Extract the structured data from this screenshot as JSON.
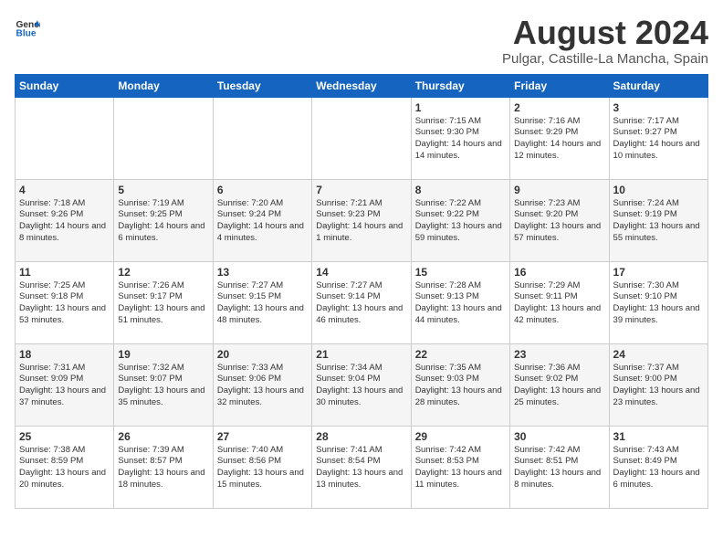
{
  "header": {
    "logo_general": "General",
    "logo_blue": "Blue",
    "title": "August 2024",
    "subtitle": "Pulgar, Castille-La Mancha, Spain"
  },
  "weekdays": [
    "Sunday",
    "Monday",
    "Tuesday",
    "Wednesday",
    "Thursday",
    "Friday",
    "Saturday"
  ],
  "weeks": [
    [
      {
        "day": "",
        "info": ""
      },
      {
        "day": "",
        "info": ""
      },
      {
        "day": "",
        "info": ""
      },
      {
        "day": "",
        "info": ""
      },
      {
        "day": "1",
        "info": "Sunrise: 7:15 AM\nSunset: 9:30 PM\nDaylight: 14 hours and 14 minutes."
      },
      {
        "day": "2",
        "info": "Sunrise: 7:16 AM\nSunset: 9:29 PM\nDaylight: 14 hours and 12 minutes."
      },
      {
        "day": "3",
        "info": "Sunrise: 7:17 AM\nSunset: 9:27 PM\nDaylight: 14 hours and 10 minutes."
      }
    ],
    [
      {
        "day": "4",
        "info": "Sunrise: 7:18 AM\nSunset: 9:26 PM\nDaylight: 14 hours and 8 minutes."
      },
      {
        "day": "5",
        "info": "Sunrise: 7:19 AM\nSunset: 9:25 PM\nDaylight: 14 hours and 6 minutes."
      },
      {
        "day": "6",
        "info": "Sunrise: 7:20 AM\nSunset: 9:24 PM\nDaylight: 14 hours and 4 minutes."
      },
      {
        "day": "7",
        "info": "Sunrise: 7:21 AM\nSunset: 9:23 PM\nDaylight: 14 hours and 1 minute."
      },
      {
        "day": "8",
        "info": "Sunrise: 7:22 AM\nSunset: 9:22 PM\nDaylight: 13 hours and 59 minutes."
      },
      {
        "day": "9",
        "info": "Sunrise: 7:23 AM\nSunset: 9:20 PM\nDaylight: 13 hours and 57 minutes."
      },
      {
        "day": "10",
        "info": "Sunrise: 7:24 AM\nSunset: 9:19 PM\nDaylight: 13 hours and 55 minutes."
      }
    ],
    [
      {
        "day": "11",
        "info": "Sunrise: 7:25 AM\nSunset: 9:18 PM\nDaylight: 13 hours and 53 minutes."
      },
      {
        "day": "12",
        "info": "Sunrise: 7:26 AM\nSunset: 9:17 PM\nDaylight: 13 hours and 51 minutes."
      },
      {
        "day": "13",
        "info": "Sunrise: 7:27 AM\nSunset: 9:15 PM\nDaylight: 13 hours and 48 minutes."
      },
      {
        "day": "14",
        "info": "Sunrise: 7:27 AM\nSunset: 9:14 PM\nDaylight: 13 hours and 46 minutes."
      },
      {
        "day": "15",
        "info": "Sunrise: 7:28 AM\nSunset: 9:13 PM\nDaylight: 13 hours and 44 minutes."
      },
      {
        "day": "16",
        "info": "Sunrise: 7:29 AM\nSunset: 9:11 PM\nDaylight: 13 hours and 42 minutes."
      },
      {
        "day": "17",
        "info": "Sunrise: 7:30 AM\nSunset: 9:10 PM\nDaylight: 13 hours and 39 minutes."
      }
    ],
    [
      {
        "day": "18",
        "info": "Sunrise: 7:31 AM\nSunset: 9:09 PM\nDaylight: 13 hours and 37 minutes."
      },
      {
        "day": "19",
        "info": "Sunrise: 7:32 AM\nSunset: 9:07 PM\nDaylight: 13 hours and 35 minutes."
      },
      {
        "day": "20",
        "info": "Sunrise: 7:33 AM\nSunset: 9:06 PM\nDaylight: 13 hours and 32 minutes."
      },
      {
        "day": "21",
        "info": "Sunrise: 7:34 AM\nSunset: 9:04 PM\nDaylight: 13 hours and 30 minutes."
      },
      {
        "day": "22",
        "info": "Sunrise: 7:35 AM\nSunset: 9:03 PM\nDaylight: 13 hours and 28 minutes."
      },
      {
        "day": "23",
        "info": "Sunrise: 7:36 AM\nSunset: 9:02 PM\nDaylight: 13 hours and 25 minutes."
      },
      {
        "day": "24",
        "info": "Sunrise: 7:37 AM\nSunset: 9:00 PM\nDaylight: 13 hours and 23 minutes."
      }
    ],
    [
      {
        "day": "25",
        "info": "Sunrise: 7:38 AM\nSunset: 8:59 PM\nDaylight: 13 hours and 20 minutes."
      },
      {
        "day": "26",
        "info": "Sunrise: 7:39 AM\nSunset: 8:57 PM\nDaylight: 13 hours and 18 minutes."
      },
      {
        "day": "27",
        "info": "Sunrise: 7:40 AM\nSunset: 8:56 PM\nDaylight: 13 hours and 15 minutes."
      },
      {
        "day": "28",
        "info": "Sunrise: 7:41 AM\nSunset: 8:54 PM\nDaylight: 13 hours and 13 minutes."
      },
      {
        "day": "29",
        "info": "Sunrise: 7:42 AM\nSunset: 8:53 PM\nDaylight: 13 hours and 11 minutes."
      },
      {
        "day": "30",
        "info": "Sunrise: 7:42 AM\nSunset: 8:51 PM\nDaylight: 13 hours and 8 minutes."
      },
      {
        "day": "31",
        "info": "Sunrise: 7:43 AM\nSunset: 8:49 PM\nDaylight: 13 hours and 6 minutes."
      }
    ]
  ]
}
